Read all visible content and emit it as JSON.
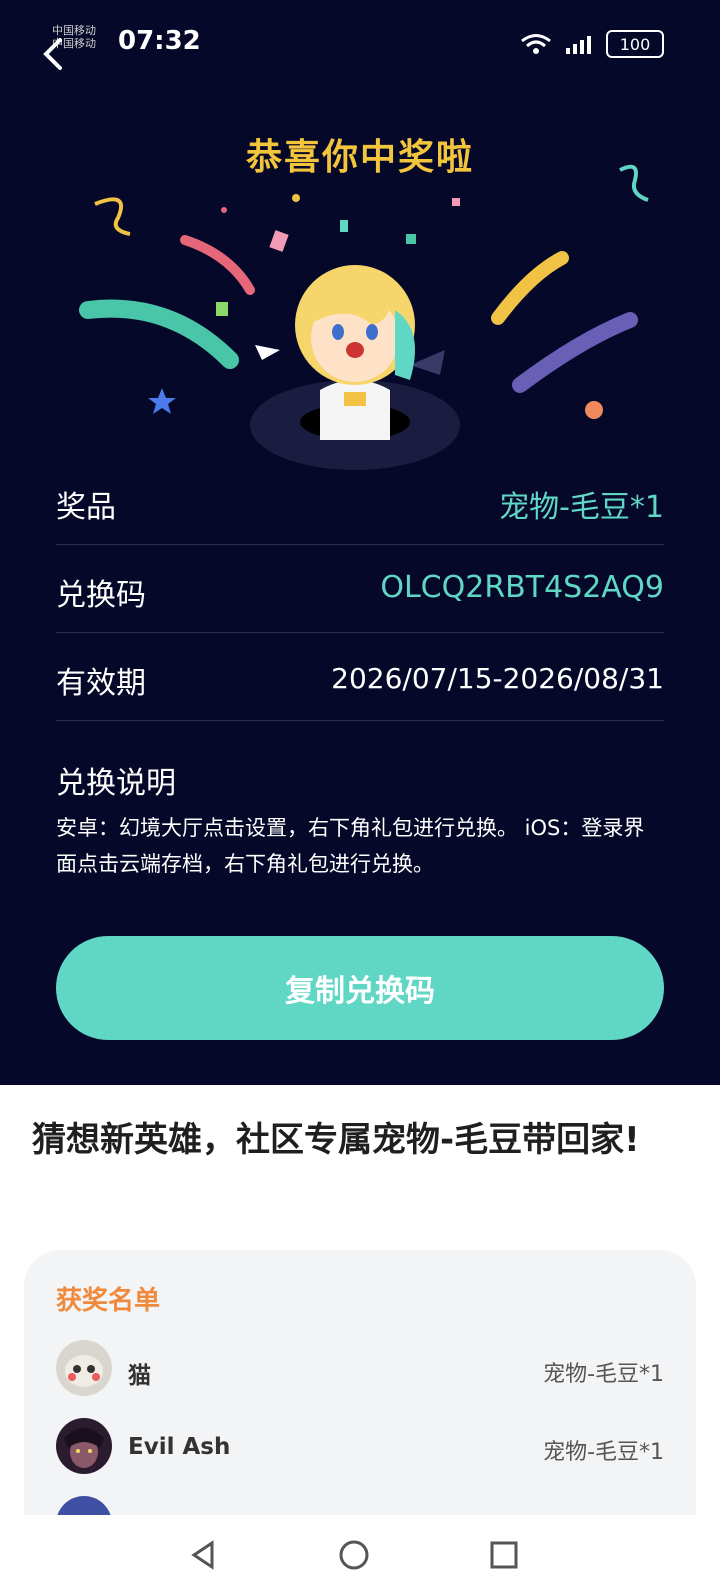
{
  "status_bar": {
    "carrier_line1": "中国移动",
    "carrier_line2": "中国移动",
    "time": "07:32",
    "battery": "100"
  },
  "header": {
    "title": "恭喜你中奖啦"
  },
  "details": {
    "prize_label": "奖品",
    "prize_value": "宠物-毛豆*1",
    "code_label": "兑换码",
    "code_value": "OLCQ2RBT4S2AQ9",
    "validity_label": "有效期",
    "validity_value": "2026/07/15-2026/08/31",
    "instructions_label": "兑换说明",
    "instructions_text": "安卓：幻境大厅点击设置，右下角礼包进行兑换。 iOS：登录界面点击云端存档，右下角礼包进行兑换。"
  },
  "copy_button": {
    "label": "复制兑换码"
  },
  "event": {
    "title": "猜想新英雄，社区专属宠物-毛豆带回家!"
  },
  "winners": {
    "title": "获奖名单",
    "items": [
      {
        "name": "猫",
        "prize": "宠物-毛豆*1"
      },
      {
        "name": "Evil Ash",
        "prize": "宠物-毛豆*1"
      }
    ]
  },
  "colors": {
    "background_dark": "#050829",
    "accent_teal": "#60d6c5",
    "title_yellow": "#f3c53d",
    "winners_orange": "#ef8a3c"
  },
  "icons": {
    "back": "chevron-left-icon",
    "nav_back": "triangle-back-icon",
    "nav_home": "circle-home-icon",
    "nav_recents": "square-recents-icon"
  }
}
